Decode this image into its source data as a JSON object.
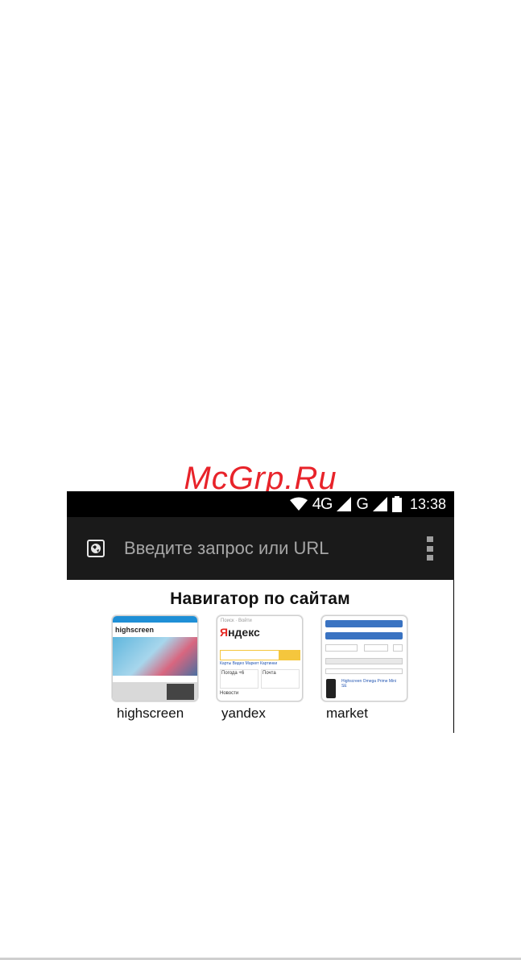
{
  "watermark": {
    "text": "McGrp.Ru"
  },
  "status_bar": {
    "network_4g": "4G",
    "network_g": "G",
    "time": "13:38",
    "icons": [
      "wifi-icon",
      "signal-icon",
      "signal-icon",
      "battery-icon"
    ]
  },
  "browser": {
    "url_placeholder": "Введите запрос или URL",
    "site_icon": "globe-icon",
    "menu_icon": "overflow-menu-icon"
  },
  "navigator": {
    "title": "Навигатор по сайтам",
    "sites": [
      {
        "label": "highscreen"
      },
      {
        "label": "yandex"
      },
      {
        "label": "market"
      }
    ]
  }
}
